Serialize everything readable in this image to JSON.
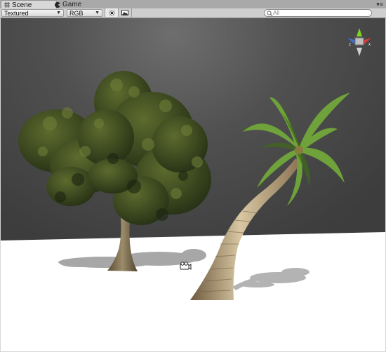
{
  "tabs": [
    {
      "label": "Scene",
      "icon": "grid-icon",
      "active": true
    },
    {
      "label": "Game",
      "icon": "pacman-icon",
      "active": false
    }
  ],
  "toolbar": {
    "render_mode": "Textured",
    "color_mode": "RGB",
    "lighting_icon": "sun-icon",
    "overlay_icon": "image-icon",
    "search_placeholder": "All"
  },
  "scene": {
    "objects": [
      "broadleaf-tree",
      "palm-tree",
      "camera-gizmo"
    ],
    "gizmo_axes": [
      "x",
      "z"
    ]
  }
}
